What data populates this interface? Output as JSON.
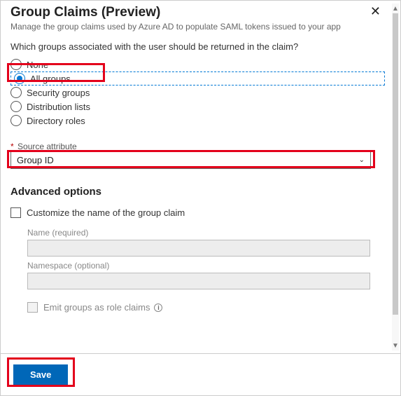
{
  "header": {
    "title": "Group Claims (Preview)",
    "subtitle": "Manage the group claims used by Azure AD to populate SAML tokens issued to your app"
  },
  "question": "Which groups associated with the user should be returned in the claim?",
  "groups": {
    "options": [
      "None",
      "All groups",
      "Security groups",
      "Distribution lists",
      "Directory roles"
    ],
    "selected": "All groups"
  },
  "source_attribute": {
    "label_prefix": "*",
    "label": "Source attribute",
    "value": "Group ID"
  },
  "advanced": {
    "title": "Advanced options",
    "customize_label": "Customize the name of the group claim",
    "name_label": "Name (required)",
    "namespace_label": "Namespace (optional)",
    "emit_label": "Emit groups as role claims"
  },
  "footer": {
    "save_label": "Save"
  }
}
